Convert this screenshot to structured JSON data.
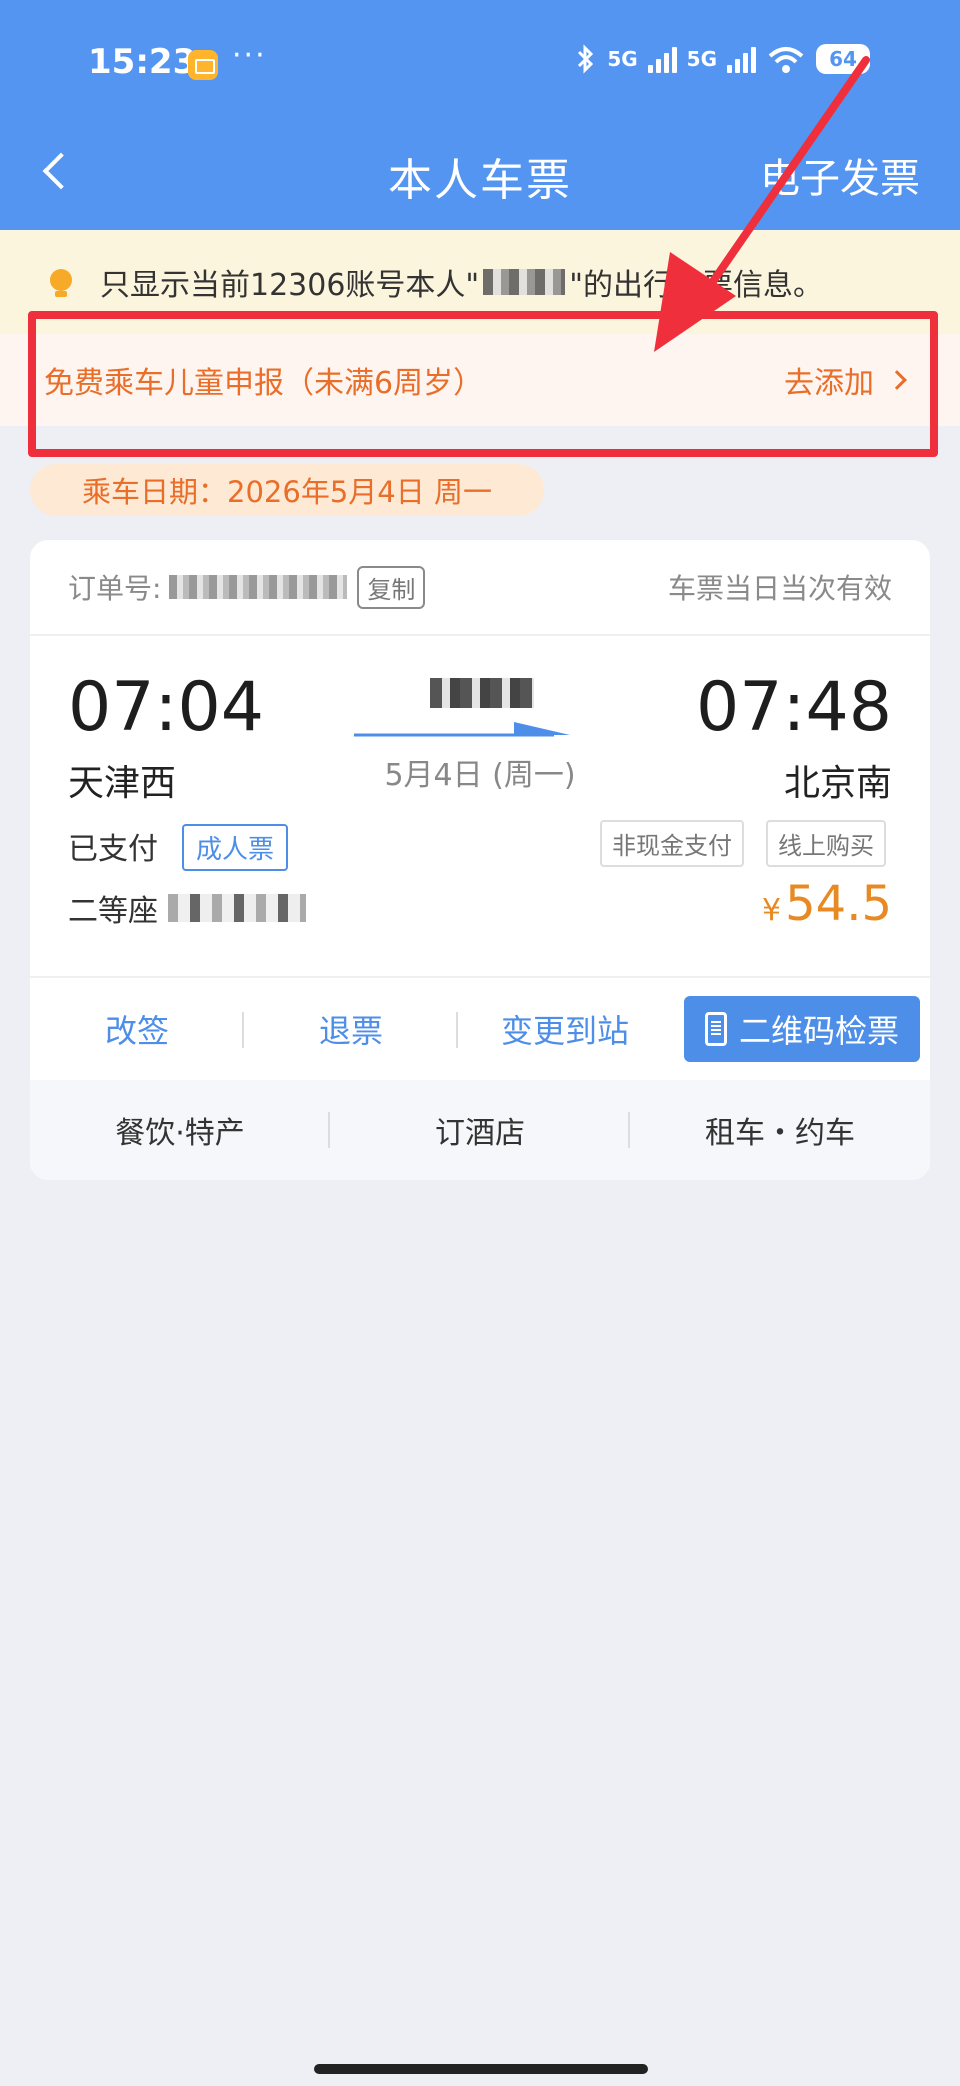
{
  "status_bar": {
    "time": "15:23",
    "dots": "···",
    "net1": "5G",
    "net2": "5G",
    "battery": "64"
  },
  "header": {
    "title": "本人车票",
    "right_action": "电子发票"
  },
  "notice": {
    "prefix": "只显示当前12306账号本人\"",
    "suffix": "\"的出行车票信息。"
  },
  "child_report": {
    "label": "免费乘车儿童申报（未满6周岁）",
    "action": "去添加"
  },
  "date_pill": "乘车日期：2026年5月4日 周一",
  "ticket": {
    "order_label": "订单号:",
    "copy_label": "复制",
    "valid_text": "车票当日当次有效",
    "departure_time": "07:04",
    "arrival_time": "07:48",
    "departure_station": "天津西",
    "arrival_station": "北京南",
    "date": "5月4日 (周一)",
    "status": "已支付",
    "ticket_type": "成人票",
    "tag_payment": "非现金支付",
    "tag_channel": "线上购买",
    "seat_class": "二等座",
    "price_symbol": "¥",
    "price": "54.5"
  },
  "actions": {
    "change": "改签",
    "refund": "退票",
    "change_station": "变更到站",
    "qr_ticket": "二维码检票"
  },
  "services": {
    "food": "餐饮·特产",
    "hotel": "订酒店",
    "car": "租车・约车"
  },
  "colors": {
    "header_blue": "#5495f2",
    "accent_orange": "#e86e2a",
    "price_orange": "#e88a24",
    "action_blue": "#4d8ee8",
    "highlight_red": "#ef2f3b"
  }
}
